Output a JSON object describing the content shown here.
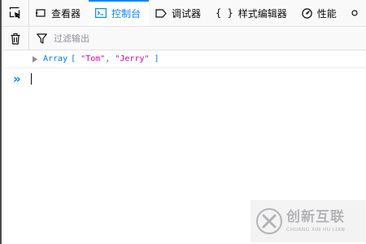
{
  "toolbar": {
    "tabs": [
      {
        "label": "查看器",
        "icon": "inspector-icon",
        "active": false
      },
      {
        "label": "控制台",
        "icon": "console-icon",
        "active": true
      },
      {
        "label": "调试器",
        "icon": "debugger-icon",
        "active": false
      },
      {
        "label": "样式编辑器",
        "icon": "style-editor-icon",
        "active": false
      },
      {
        "label": "性能",
        "icon": "performance-icon",
        "active": false
      }
    ],
    "accent_color": "#0a84ff"
  },
  "filterbar": {
    "filter_placeholder": "过滤输出"
  },
  "console": {
    "entries": [
      {
        "type": "Array",
        "open": "[",
        "items": [
          "\"Tom\"",
          "\"Jerry\""
        ],
        "separator": ",",
        "close": "]"
      }
    ],
    "prompt": "»"
  },
  "watermark": {
    "main": "创新互联",
    "sub": "CHUANG XIN HU LIAN"
  }
}
